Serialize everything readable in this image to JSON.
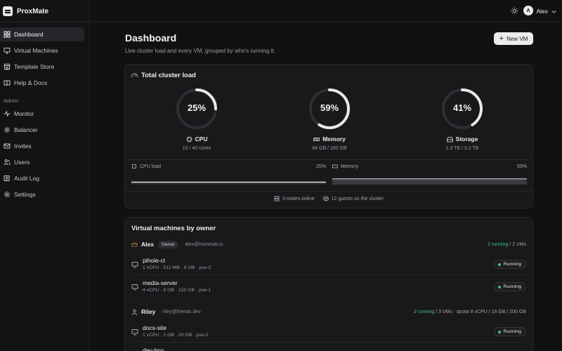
{
  "app": {
    "name": "ProxMate"
  },
  "sidebar": {
    "items": [
      {
        "label": "Dashboard",
        "icon": "dashboard-icon",
        "active": true
      },
      {
        "label": "Virtual Machines",
        "icon": "monitor-icon"
      },
      {
        "label": "Template Store",
        "icon": "store-icon"
      },
      {
        "label": "Help & Docs",
        "icon": "book-icon"
      }
    ],
    "admin_label": "Admin",
    "admin_items": [
      {
        "label": "Monitor",
        "icon": "activity-icon"
      },
      {
        "label": "Balancer",
        "icon": "gear-icon"
      },
      {
        "label": "Invites",
        "icon": "mail-icon"
      },
      {
        "label": "Users",
        "icon": "users-icon"
      },
      {
        "label": "Audit Log",
        "icon": "log-icon"
      },
      {
        "label": "Settings",
        "icon": "settings-icon"
      }
    ]
  },
  "topbar": {
    "user_initial": "A",
    "user_name": "Alex"
  },
  "page": {
    "title": "Dashboard",
    "subtitle": "Live cluster load and every VM, grouped by who's running it.",
    "new_vm_label": "New VM"
  },
  "cluster": {
    "title": "Total cluster load",
    "gauges": [
      {
        "pct_text": "25%",
        "pct": 0.25,
        "label": "CPU",
        "detail": "10 / 40 cores",
        "icon": "cpu-icon"
      },
      {
        "pct_text": "59%",
        "pct": 0.59,
        "label": "Memory",
        "detail": "94 GB / 160 GB",
        "icon": "memory-icon"
      },
      {
        "pct_text": "41%",
        "pct": 0.41,
        "label": "Storage",
        "detail": "1.3 TB / 3.2 TB",
        "icon": "storage-icon"
      }
    ],
    "cpu_load": {
      "label": "CPU load",
      "pct_text": "25%",
      "level": 0.25
    },
    "memory_load": {
      "label": "Memory",
      "pct_text": "59%",
      "level": 0.59
    },
    "nodes_text": "3 nodes online",
    "guests_text": "12 guests on the cluster"
  },
  "vms": {
    "title": "Virtual machines by owner",
    "owners": [
      {
        "name": "Alex",
        "badge": "Owner",
        "email": "· alex@homelab.io",
        "running": "2 running",
        "rest": " / 2 VMs",
        "vms": [
          {
            "name": "pihole-ct",
            "spec": "1 vCPU · 512 MB · 8 GB · pve-2",
            "status": "Running"
          },
          {
            "name": "media-server",
            "spec": "4 vCPU · 8 GB · 120 GB · pve-1",
            "status": "Running"
          }
        ]
      },
      {
        "name": "Riley",
        "email": "· riley@friends.dev",
        "running": "2 running",
        "rest": " / 3 VMs · quota 8 vCPU / 16 GB / 200 GB",
        "vms": [
          {
            "name": "docs-site",
            "spec": "1 vCPU · 2 GB · 20 GB · pve-2",
            "status": "Running"
          },
          {
            "name": "dev-box",
            "spec": "",
            "status": ""
          }
        ]
      }
    ]
  },
  "colors": {
    "accent_green": "#3ec47a",
    "background": "#111113",
    "card": "#19191c"
  }
}
